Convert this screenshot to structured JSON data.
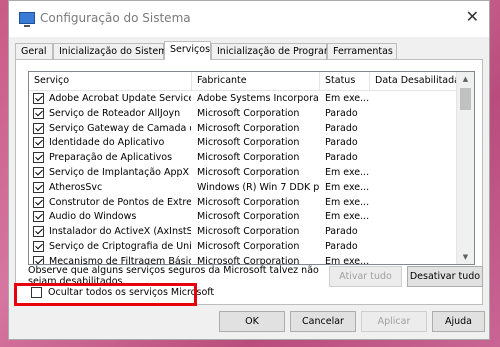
{
  "window": {
    "title": "Configuração do Sistema",
    "close_glyph": "✕"
  },
  "tabs": [
    {
      "label": "Geral"
    },
    {
      "label": "Inicialização do Sistema"
    },
    {
      "label": "Serviços",
      "active": true
    },
    {
      "label": "Inicialização de Programas"
    },
    {
      "label": "Ferramentas"
    }
  ],
  "services": {
    "columns": [
      "Serviço",
      "Fabricante",
      "Status",
      "Data Desabilitada"
    ],
    "rows": [
      {
        "checked": true,
        "name": "Adobe Acrobat Update Service",
        "vendor": "Adobe Systems Incorporated",
        "status": "Em exe...",
        "disabled_date": ""
      },
      {
        "checked": true,
        "name": "Serviço de Roteador AllJoyn",
        "vendor": "Microsoft Corporation",
        "status": "Parado",
        "disabled_date": ""
      },
      {
        "checked": true,
        "name": "Serviço Gateway de Camada de ...",
        "vendor": "Microsoft Corporation",
        "status": "Parado",
        "disabled_date": ""
      },
      {
        "checked": true,
        "name": "Identidade do Aplicativo",
        "vendor": "Microsoft Corporation",
        "status": "Parado",
        "disabled_date": ""
      },
      {
        "checked": true,
        "name": "Preparação de Aplicativos",
        "vendor": "Microsoft Corporation",
        "status": "Parado",
        "disabled_date": ""
      },
      {
        "checked": true,
        "name": "Serviço de Implantação AppX (A...",
        "vendor": "Microsoft Corporation",
        "status": "Em exe...",
        "disabled_date": ""
      },
      {
        "checked": true,
        "name": "AtherosSvc",
        "vendor": "Windows (R) Win 7 DDK pr...",
        "status": "Em exe...",
        "disabled_date": ""
      },
      {
        "checked": true,
        "name": "Construtor de Pontos de Extrem...",
        "vendor": "Microsoft Corporation",
        "status": "Em exe...",
        "disabled_date": ""
      },
      {
        "checked": true,
        "name": "Áudio do Windows",
        "vendor": "Microsoft Corporation",
        "status": "Em exe...",
        "disabled_date": ""
      },
      {
        "checked": true,
        "name": "Instalador do ActiveX (AxInstSV)",
        "vendor": "Microsoft Corporation",
        "status": "Parado",
        "disabled_date": ""
      },
      {
        "checked": true,
        "name": "Serviço de Criptografia de Unida...",
        "vendor": "Microsoft Corporation",
        "status": "Parado",
        "disabled_date": ""
      },
      {
        "checked": true,
        "name": "Mecanismo de Filtragem Básica",
        "vendor": "Microsoft Corporation",
        "status": "Em exe...",
        "disabled_date": ""
      }
    ]
  },
  "note_text": "Observe que alguns serviços seguros da Microsoft talvez não sejam desabilitados.",
  "buttons": {
    "enable_all": "Ativar tudo",
    "disable_all": "Desativar tudo",
    "ok": "OK",
    "cancel": "Cancelar",
    "apply": "Aplicar",
    "help": "Ajuda"
  },
  "hide_ms": {
    "label": "Ocultar todos os serviços Microsoft",
    "checked": false
  },
  "highlight_color": "#e8000d",
  "scroll_glyphs": {
    "up": "▲",
    "down": "▼"
  }
}
